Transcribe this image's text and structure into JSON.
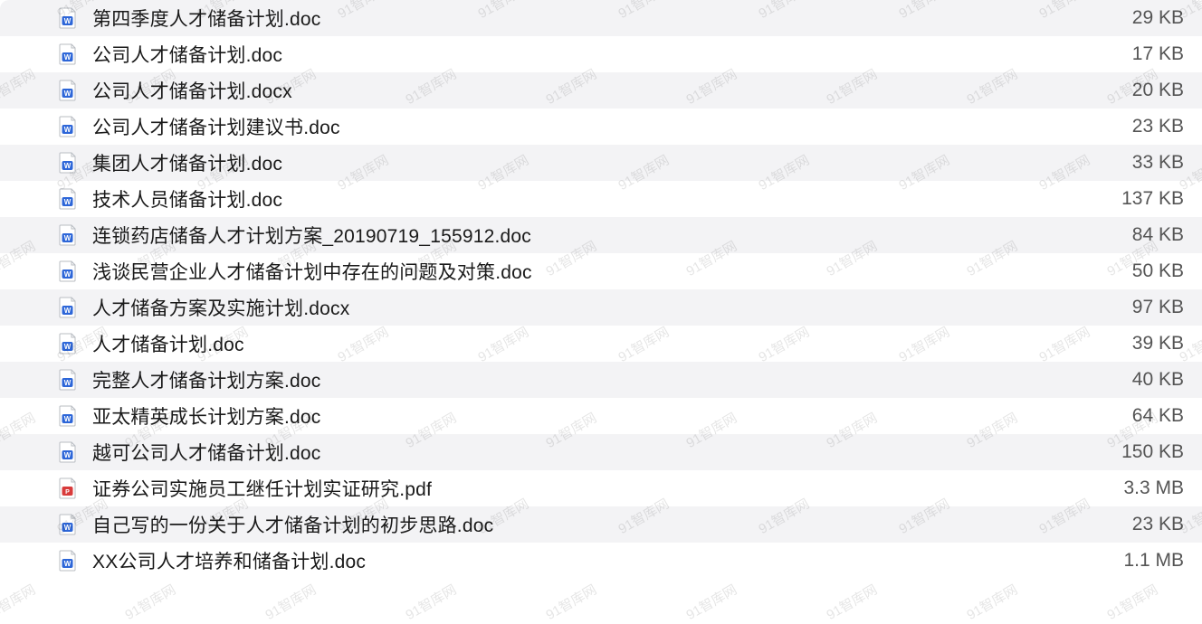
{
  "watermark_text": "91智库网",
  "files": [
    {
      "name": "第四季度人才储备计划.doc",
      "size": "29 KB",
      "type": "word"
    },
    {
      "name": "公司人才储备计划.doc",
      "size": "17 KB",
      "type": "word"
    },
    {
      "name": "公司人才储备计划.docx",
      "size": "20 KB",
      "type": "word"
    },
    {
      "name": "公司人才储备计划建议书.doc",
      "size": "23 KB",
      "type": "word"
    },
    {
      "name": "集团人才储备计划.doc",
      "size": "33 KB",
      "type": "word"
    },
    {
      "name": "技术人员储备计划.doc",
      "size": "137 KB",
      "type": "word"
    },
    {
      "name": "连锁药店储备人才计划方案_20190719_155912.doc",
      "size": "84 KB",
      "type": "word"
    },
    {
      "name": "浅谈民营企业人才储备计划中存在的问题及对策.doc",
      "size": "50 KB",
      "type": "word"
    },
    {
      "name": "人才储备方案及实施计划.docx",
      "size": "97 KB",
      "type": "word"
    },
    {
      "name": "人才储备计划.doc",
      "size": "39 KB",
      "type": "word"
    },
    {
      "name": "完整人才储备计划方案.doc",
      "size": "40 KB",
      "type": "word"
    },
    {
      "name": "亚太精英成长计划方案.doc",
      "size": "64 KB",
      "type": "word"
    },
    {
      "name": "越可公司人才储备计划.doc",
      "size": "150 KB",
      "type": "word"
    },
    {
      "name": "证券公司实施员工继任计划实证研究.pdf",
      "size": "3.3 MB",
      "type": "pdf"
    },
    {
      "name": "自己写的一份关于人才储备计划的初步思路.doc",
      "size": "23 KB",
      "type": "word"
    },
    {
      "name": "XX公司人才培养和储备计划.doc",
      "size": "1.1 MB",
      "type": "word"
    }
  ]
}
